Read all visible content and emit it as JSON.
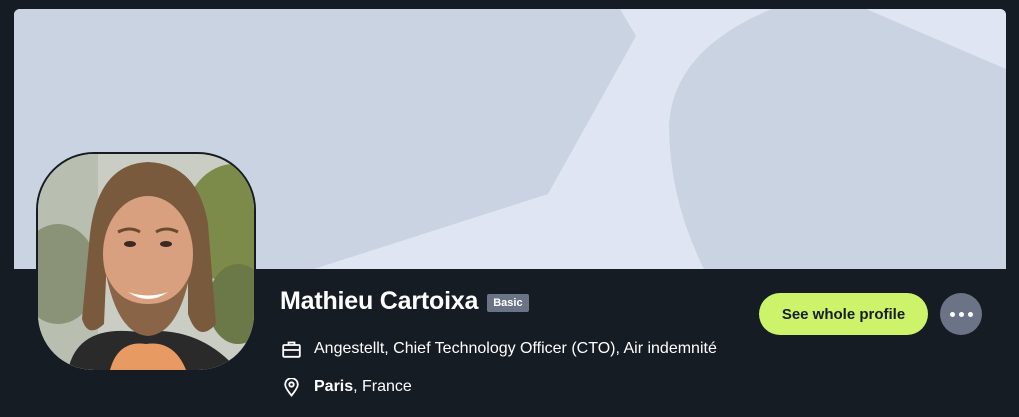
{
  "profile": {
    "name": "Mathieu Cartoixa",
    "badge": "Basic",
    "job": "Angestellt, Chief Technology Officer (CTO), Air indemnité",
    "location": {
      "city": "Paris",
      "separator": ", ",
      "country": "France"
    }
  },
  "actions": {
    "see_profile_label": "See whole profile",
    "more_icon": "more-horizontal-icon"
  },
  "icons": {
    "job": "briefcase-icon",
    "location": "map-pin-icon"
  },
  "colors": {
    "background": "#161c24",
    "banner_light": "#dfe5f3",
    "banner_shape": "#cad3e1",
    "primary_button": "#cdf36b",
    "badge": "#6b7386",
    "text": "#ffffff"
  }
}
